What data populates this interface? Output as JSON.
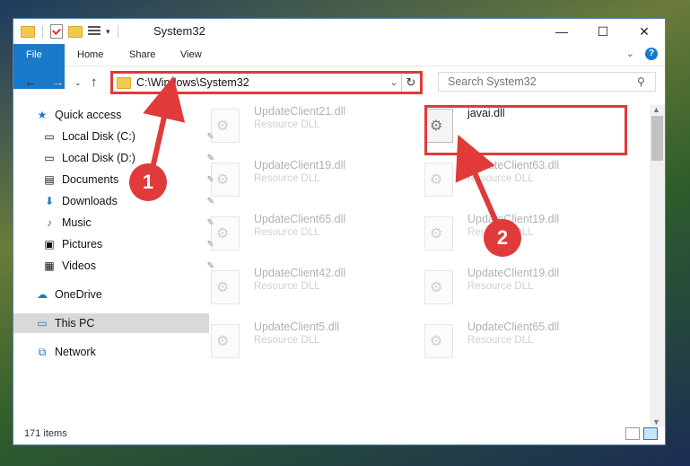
{
  "window": {
    "title": "System32",
    "controls": {
      "minimize": "—",
      "maximize": "☐",
      "close": "✕"
    }
  },
  "ribbon": {
    "tabs": [
      "File",
      "Home",
      "Share",
      "View"
    ]
  },
  "address": {
    "path": "C:\\Windows\\System32",
    "search_placeholder": "Search System32"
  },
  "sidebar": {
    "items": [
      {
        "label": "Quick access",
        "icon": "star-icon",
        "pinned": false
      },
      {
        "label": "Local Disk (C:)",
        "icon": "drive-icon",
        "pinned": true
      },
      {
        "label": "Local Disk (D:)",
        "icon": "drive-icon",
        "pinned": true
      },
      {
        "label": "Documents",
        "icon": "documents-icon",
        "pinned": true
      },
      {
        "label": "Downloads",
        "icon": "download-icon",
        "pinned": true
      },
      {
        "label": "Music",
        "icon": "music-icon",
        "pinned": true
      },
      {
        "label": "Pictures",
        "icon": "pictures-icon",
        "pinned": true
      },
      {
        "label": "Videos",
        "icon": "videos-icon",
        "pinned": true
      },
      {
        "label": "OneDrive",
        "icon": "cloud-icon",
        "pinned": false
      },
      {
        "label": "This PC",
        "icon": "pc-icon",
        "pinned": false,
        "selected": true
      },
      {
        "label": "Network",
        "icon": "network-icon",
        "pinned": false
      }
    ]
  },
  "files": {
    "left": [
      {
        "name": "UpdateClient21.dll",
        "type": "Resource DLL"
      },
      {
        "name": "UpdateClient19.dll",
        "type": "Resource DLL"
      },
      {
        "name": "UpdateClient65.dll",
        "type": "Resource DLL"
      },
      {
        "name": "UpdateClient42.dll",
        "type": "Resource DLL"
      },
      {
        "name": "UpdateClient5.dll",
        "type": "Resource DLL"
      }
    ],
    "right": [
      {
        "name": "javai.dll",
        "type": ""
      },
      {
        "name": "UpdateClient63.dll",
        "type": "Resource DLL"
      },
      {
        "name": "UpdateClient19.dll",
        "type": "Resource DLL"
      },
      {
        "name": "UpdateClient19.dll",
        "type": "Resource DLL"
      },
      {
        "name": "UpdateClient65.dll",
        "type": "Resource DLL"
      }
    ]
  },
  "status": {
    "items": "171 items"
  },
  "annotations": {
    "step1": "1",
    "step2": "2"
  },
  "colors": {
    "accent": "#1979ca",
    "highlight": "#e03a3a"
  }
}
